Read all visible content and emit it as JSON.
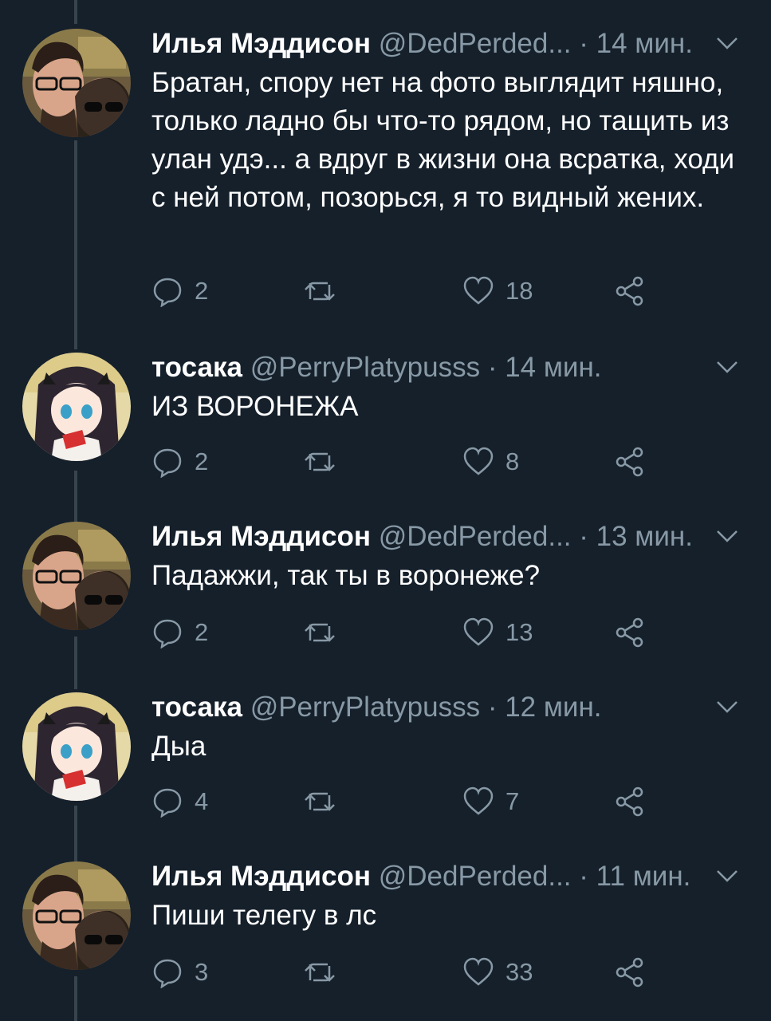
{
  "colors": {
    "background": "#15202b",
    "muted": "#8899a6",
    "thread": "#38444d"
  },
  "tweets": [
    {
      "name": "Илья Мэддисон",
      "handle": "@DedPerded...",
      "time": "· 14 мин.",
      "avatar": "photo-avatar",
      "text": "Братан, спору нет на фото выглядит няшно, только ладно бы что-то рядом, но тащить из улан удэ... а вдруг в жизни она всратка, ходи с ней потом, позорься, я то видный жених.",
      "replies": "2",
      "likes": "18"
    },
    {
      "name": "тосака",
      "handle": "@PerryPlatypusss",
      "time": "· 14 мин.",
      "avatar": "anime-avatar",
      "text": "ИЗ ВОРОНЕЖА",
      "replies": "2",
      "likes": "8"
    },
    {
      "name": "Илья Мэддисон",
      "handle": "@DedPerded...",
      "time": "· 13 мин.",
      "avatar": "photo-avatar",
      "text": "Падажжи, так ты в воронеже?",
      "replies": "2",
      "likes": "13"
    },
    {
      "name": "тосака",
      "handle": "@PerryPlatypusss",
      "time": "· 12 мин.",
      "avatar": "anime-avatar",
      "text": "Дыа",
      "replies": "4",
      "likes": "7"
    },
    {
      "name": "Илья Мэддисон",
      "handle": "@DedPerded...",
      "time": "· 11 мин.",
      "avatar": "photo-avatar",
      "text": "Пиши телегу в лс",
      "replies": "3",
      "likes": "33"
    }
  ]
}
